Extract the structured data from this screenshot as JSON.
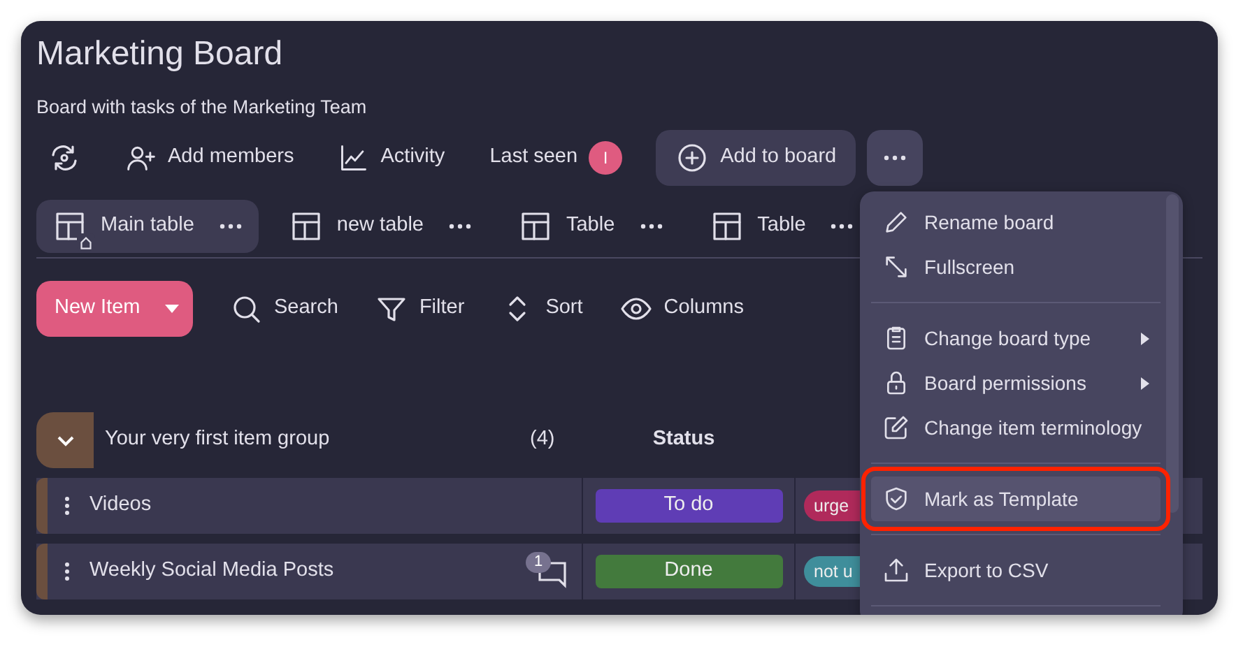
{
  "board": {
    "title": "Marketing Board",
    "description": "Board with tasks of the Marketing Team"
  },
  "toolbar": [
    {
      "kind": "icon"
    },
    {
      "kind": "button",
      "label": "Add members"
    },
    {
      "kind": "button",
      "label": "Activity"
    },
    {
      "kind": "last_seen",
      "label": "Last seen",
      "avatar": "I"
    },
    {
      "kind": "pill",
      "label": "Add to board"
    },
    {
      "kind": "more",
      "selected": true
    }
  ],
  "tabs": [
    {
      "label": "Main table",
      "selected": true,
      "home": true
    },
    {
      "label": "new table",
      "selected": false,
      "home": false
    },
    {
      "label": "Table",
      "selected": false,
      "home": false
    },
    {
      "label": "Table",
      "selected": false,
      "home": false
    }
  ],
  "actions": [
    {
      "kind": "split",
      "label": "New Item"
    },
    {
      "kind": "button",
      "label": "Search"
    },
    {
      "kind": "button",
      "label": "Filter"
    },
    {
      "kind": "button",
      "label": "Sort"
    },
    {
      "kind": "button",
      "label": "Columns"
    }
  ],
  "group": {
    "name": "Your very first item group",
    "count": "(4)",
    "expanded": true,
    "color": "#6b4f3f",
    "columns": [
      "Status"
    ],
    "rows": [
      {
        "name": "Videos",
        "status": {
          "label": "To do",
          "color": "#5f3db5"
        },
        "tag": {
          "label": "urge",
          "color": "#b02a5b"
        }
      },
      {
        "name": "Weekly Social Media Posts",
        "comments": "1",
        "status": {
          "label": "Done",
          "color": "#437a3d"
        },
        "tag": {
          "label": "not u",
          "color": "#3f8e9b"
        }
      }
    ]
  },
  "menu": {
    "items": [
      {
        "kind": "item",
        "label": "Rename board",
        "selected": false
      },
      {
        "kind": "item",
        "label": "Fullscreen",
        "selected": false
      },
      {
        "kind": "divider"
      },
      {
        "kind": "item",
        "label": "Change board type",
        "submenu": true,
        "selected": false
      },
      {
        "kind": "item",
        "label": "Board permissions",
        "submenu": true,
        "selected": false
      },
      {
        "kind": "item",
        "label": "Change item terminology",
        "selected": false
      },
      {
        "kind": "divider"
      },
      {
        "kind": "item",
        "label": "Mark as Template",
        "selected": true,
        "boxed": true
      },
      {
        "kind": "divider"
      },
      {
        "kind": "item",
        "label": "Export to CSV",
        "selected": false
      },
      {
        "kind": "divider"
      }
    ]
  }
}
